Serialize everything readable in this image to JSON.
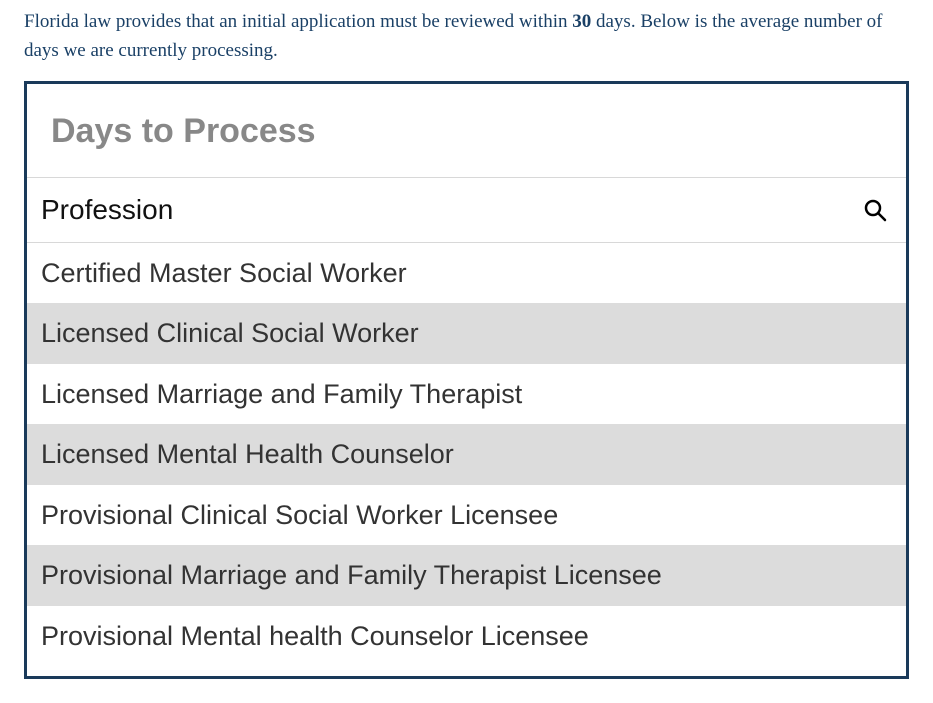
{
  "intro": {
    "prefix": "Florida law provides that an initial application must be reviewed within ",
    "bold": "30",
    "suffix": " days. Below is the average number of days we are currently processing."
  },
  "widget": {
    "title": "Days to Process",
    "column_header": "Profession",
    "rows": [
      "Certified Master Social Worker",
      "Licensed Clinical Social Worker",
      "Licensed Marriage and Family Therapist",
      "Licensed Mental Health Counselor",
      "Provisional Clinical Social Worker Licensee",
      "Provisional Marriage and Family Therapist Licensee",
      "Provisional Mental health Counselor Licensee"
    ]
  }
}
